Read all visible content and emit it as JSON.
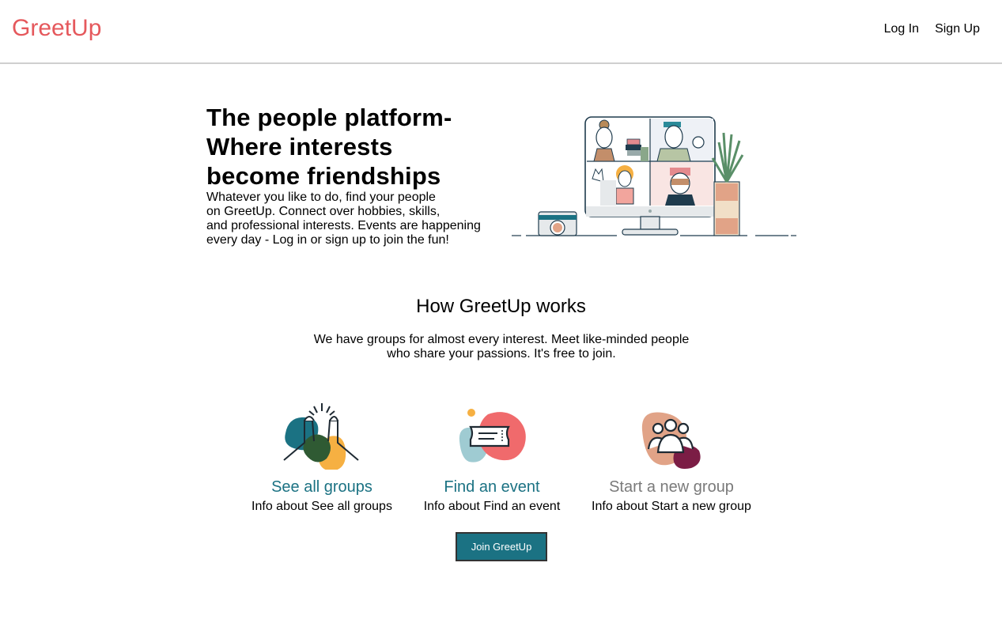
{
  "header": {
    "logo": "GreetUp",
    "nav": {
      "login": "Log In",
      "signup": "Sign Up"
    }
  },
  "hero": {
    "title_lines": [
      "The people platform-",
      "Where interests",
      "become friendships"
    ],
    "description_lines": [
      "Whatever you like to do, find your people",
      "on GreetUp. Connect over hobbies, skills,",
      "and professional interests. Events are happening",
      "every day - Log in or sign up to join the fun!"
    ],
    "illustration_icon": "video-call-illustration"
  },
  "how": {
    "title": "How GreetUp works",
    "description_lines": [
      "We have groups for almost every interest. Meet like-minded people",
      "who share your passions. It's free to join."
    ]
  },
  "cards": [
    {
      "title": "See all groups",
      "info": "Info about See all groups",
      "icon": "high-five-icon",
      "color": "#1b7283"
    },
    {
      "title": "Find an event",
      "info": "Info about Find an event",
      "icon": "ticket-icon",
      "color": "#1b7283"
    },
    {
      "title": "Start a new group",
      "info": "Info about Start a new group",
      "icon": "people-group-icon",
      "color": "#7a7a7a"
    }
  ],
  "cta": {
    "label": "Join GreetUp"
  },
  "colors": {
    "brand": "#e5585c",
    "teal": "#1b7283",
    "muted": "#7a7a7a"
  }
}
